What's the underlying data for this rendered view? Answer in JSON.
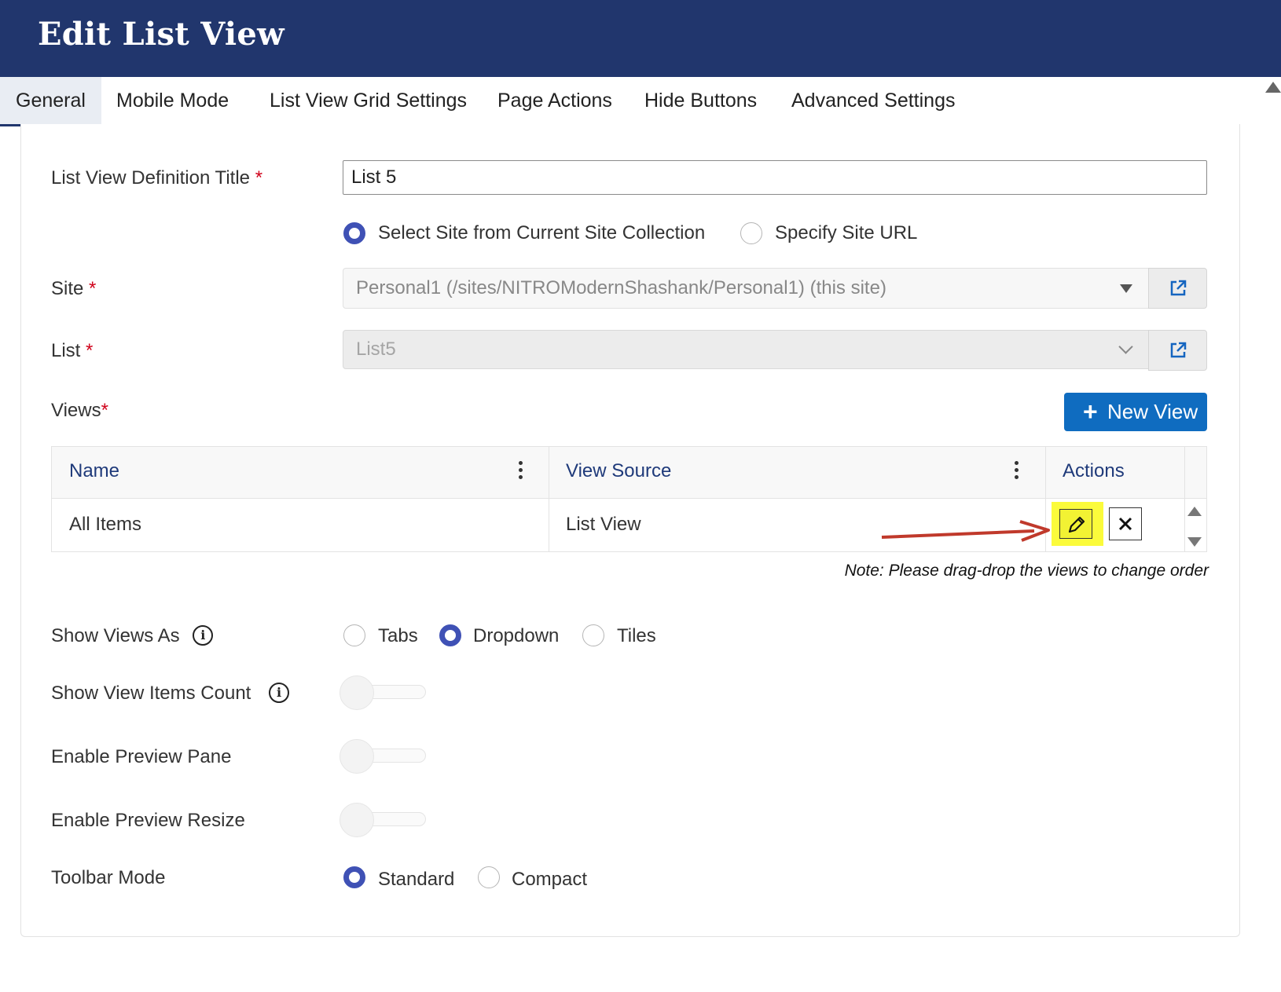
{
  "header": {
    "title": "Edit List View"
  },
  "tabs": [
    {
      "label": "General"
    },
    {
      "label": "Mobile Mode"
    },
    {
      "label": "List View Grid Settings"
    },
    {
      "label": "Page Actions"
    },
    {
      "label": "Hide Buttons"
    },
    {
      "label": "Advanced Settings"
    }
  ],
  "form": {
    "title_label": "List View Definition Title",
    "title_value": "List 5",
    "required_mark": "*",
    "site_source": {
      "options": [
        "Select Site from Current Site Collection",
        "Specify Site URL"
      ],
      "selected": "Select Site from Current Site Collection"
    },
    "site_label": "Site",
    "site_value": "Personal1 (/sites/NITROModernShashank/Personal1) (this site)",
    "list_label": "List",
    "list_value": "List5",
    "views_label": "Views",
    "new_view_label": "New View",
    "new_view_plus": "+",
    "views_grid": {
      "columns": [
        "Name",
        "View Source",
        "Actions"
      ],
      "rows": [
        {
          "name": "All Items",
          "source": "List View"
        }
      ]
    },
    "note": "Note: Please drag-drop the views to change order",
    "show_views_as_label": "Show Views As",
    "show_views_as": {
      "options": [
        "Tabs",
        "Dropdown",
        "Tiles"
      ],
      "selected": "Dropdown"
    },
    "show_view_items_count_label": "Show View Items Count",
    "enable_preview_pane_label": "Enable Preview Pane",
    "enable_preview_resize_label": "Enable Preview Resize",
    "toolbar_mode_label": "Toolbar Mode",
    "toolbar_mode": {
      "options": [
        "Standard",
        "Compact"
      ],
      "selected": "Standard"
    },
    "toggles": {
      "show_view_items_count": false,
      "enable_preview_pane": false,
      "enable_preview_resize": false
    },
    "info_glyph": "i"
  },
  "colors": {
    "header_bg": "#21366d",
    "accent": "#3f51b5",
    "primary_button": "#0f6cc0",
    "highlight": "#fbfb3b",
    "annotation_arrow": "#c0392b"
  },
  "icons": {
    "external_link": "external-link-icon",
    "edit": "pencil-icon",
    "delete": "close-icon",
    "column_menu": "kebab-menu-icon"
  }
}
